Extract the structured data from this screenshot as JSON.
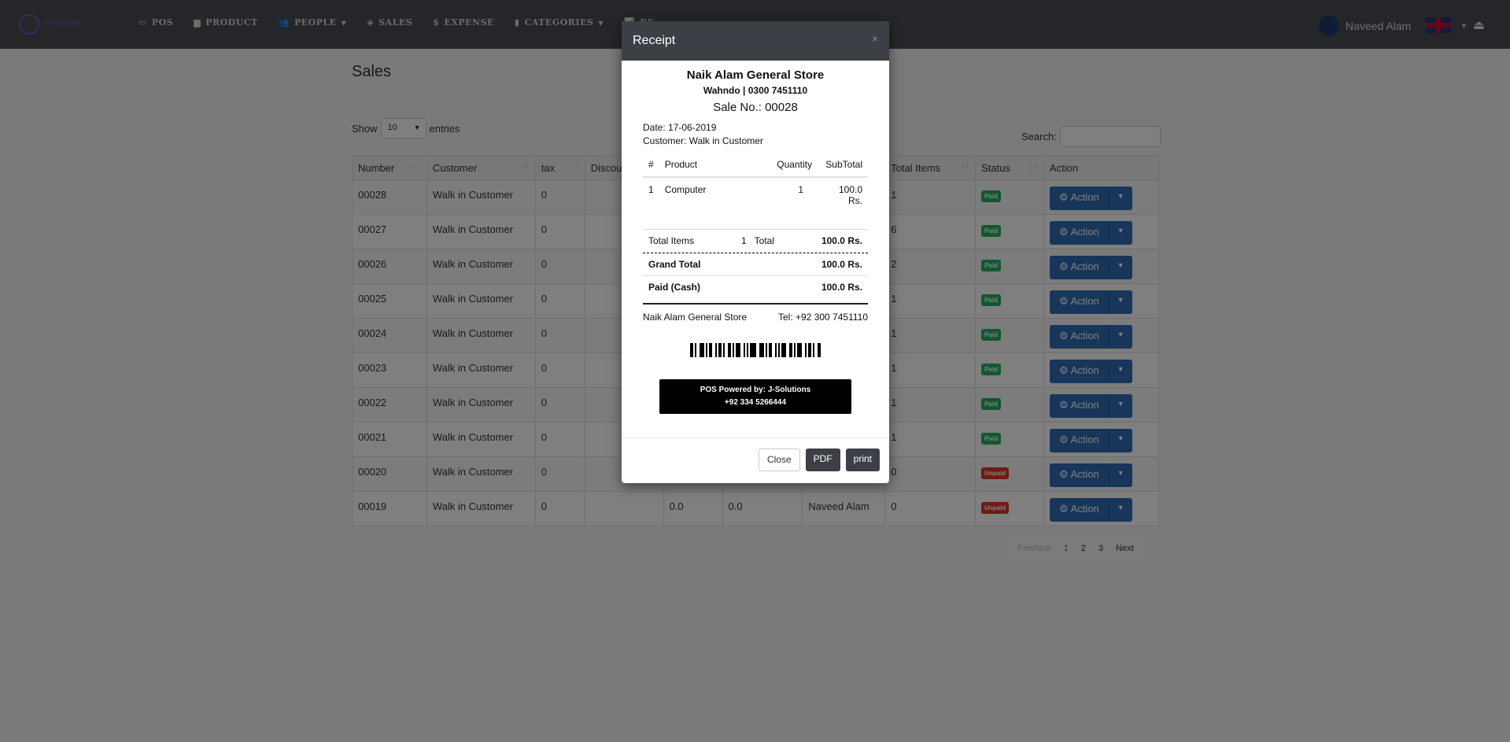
{
  "nav": {
    "logo_text": "GeneralStore",
    "items": [
      {
        "label": "POS",
        "icon": "credit-card-icon"
      },
      {
        "label": "PRODUCT",
        "icon": "archive-icon"
      },
      {
        "label": "PEOPLE",
        "icon": "users-icon",
        "dropdown": true
      },
      {
        "label": "SALES",
        "icon": "tag-icon"
      },
      {
        "label": "EXPENSE",
        "icon": "dollar-icon"
      },
      {
        "label": "CATEGORIES",
        "icon": "bookmark-icon",
        "dropdown": true
      },
      {
        "label": "RE",
        "icon": "chart-line-icon"
      }
    ],
    "user": "Naveed Alam"
  },
  "page": {
    "title": "Sales",
    "show": "Show",
    "entries": "entries",
    "length": "10",
    "search_label": "Search:",
    "search_value": ""
  },
  "table": {
    "headers": [
      "Number",
      "Customer",
      "tax",
      "Discou",
      "",
      "",
      "",
      "Total Items",
      "Status",
      "Action"
    ],
    "rows": [
      {
        "number": "00028",
        "customer": "Walk in Customer",
        "tax": "0",
        "c5": "",
        "c6": "",
        "c7": "",
        "items": "1",
        "status": "Paid"
      },
      {
        "number": "00027",
        "customer": "Walk in Customer",
        "tax": "0",
        "c5": "",
        "c6": "",
        "c7": "",
        "items": "6",
        "status": "Paid"
      },
      {
        "number": "00026",
        "customer": "Walk in Customer",
        "tax": "0",
        "c5": "",
        "c6": "",
        "c7": "",
        "items": "2",
        "status": "Paid"
      },
      {
        "number": "00025",
        "customer": "Walk in Customer",
        "tax": "0",
        "c5": "",
        "c6": "",
        "c7": "",
        "items": "1",
        "status": "Paid"
      },
      {
        "number": "00024",
        "customer": "Walk in Customer",
        "tax": "0",
        "c5": "",
        "c6": "",
        "c7": "",
        "items": "1",
        "status": "Paid"
      },
      {
        "number": "00023",
        "customer": "Walk in Customer",
        "tax": "0",
        "c5": "",
        "c6": "",
        "c7": "",
        "items": "1",
        "status": "Paid"
      },
      {
        "number": "00022",
        "customer": "Walk in Customer",
        "tax": "0",
        "c5": "",
        "c6": "",
        "c7": "",
        "items": "1",
        "status": "Paid"
      },
      {
        "number": "00021",
        "customer": "Walk in Customer",
        "tax": "0",
        "c5": "",
        "c6": "",
        "c7": "",
        "items": "1",
        "status": "Paid"
      },
      {
        "number": "00020",
        "customer": "Walk in Customer",
        "tax": "0",
        "c5": "",
        "c6": "",
        "c7": "",
        "items": "0",
        "status": "Unpaid"
      },
      {
        "number": "00019",
        "customer": "Walk in Customer",
        "tax": "0",
        "c5": "0.0",
        "c6": "0.0",
        "c7": "Naveed Alam",
        "items": "0",
        "status": "Unpaid"
      }
    ],
    "action_label": "Action"
  },
  "pagination": {
    "previous": "Previous",
    "pages": [
      "1",
      "2",
      "3"
    ],
    "next": "Next",
    "current": "1"
  },
  "modal": {
    "title": "Receipt",
    "close_x": "×",
    "store": "Naik Alam General Store",
    "address": "Wahndo | 0300 7451110",
    "sale_no": "Sale No.: 00028",
    "date": "Date: 17-06-2019",
    "customer": "Customer: Walk in Customer",
    "cols": [
      "#",
      "Product",
      "Quantity",
      "SubTotal"
    ],
    "items": [
      {
        "n": "1",
        "product": "Computer",
        "qty": "1",
        "subtotal": "100.0 Rs."
      }
    ],
    "total_items_label": "Total Items",
    "total_items": "1",
    "total_label": "Total",
    "total": "100.0 Rs.",
    "grand_total_label": "Grand Total",
    "grand_total": "100.0 Rs.",
    "paid_label": "Paid (Cash)",
    "paid": "100.0 Rs.",
    "footer_store": "Naik Alam General Store",
    "tel": "Tel: +92 300 7451110",
    "powered": "POS Powered by: J-Solutions",
    "powered_phone": "+92 334 5266444",
    "buttons": {
      "close": "Close",
      "pdf": "PDF",
      "print": "print"
    }
  },
  "colors": {
    "paid": "#27ae60",
    "unpaid": "#d9372a",
    "action": "#2f6db5",
    "modal_header": "#3c4046"
  }
}
